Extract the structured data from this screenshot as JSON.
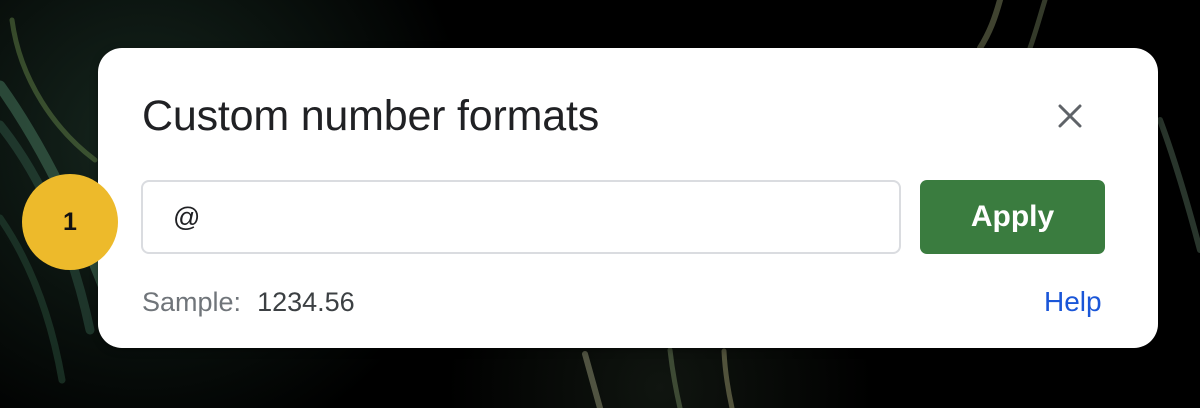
{
  "dialog": {
    "title": "Custom number formats",
    "close_icon": "close-icon",
    "format_input": {
      "value": "@"
    },
    "apply_label": "Apply",
    "sample": {
      "label": "Sample:",
      "value": "1234.56"
    },
    "help_label": "Help"
  },
  "step_badge": {
    "number": "1"
  },
  "colors": {
    "dialog_background": "#ffffff",
    "apply_button": "#3a7c3f",
    "help_link": "#1a56d8",
    "step_badge": "#edba2b",
    "page_background": "#000000"
  }
}
